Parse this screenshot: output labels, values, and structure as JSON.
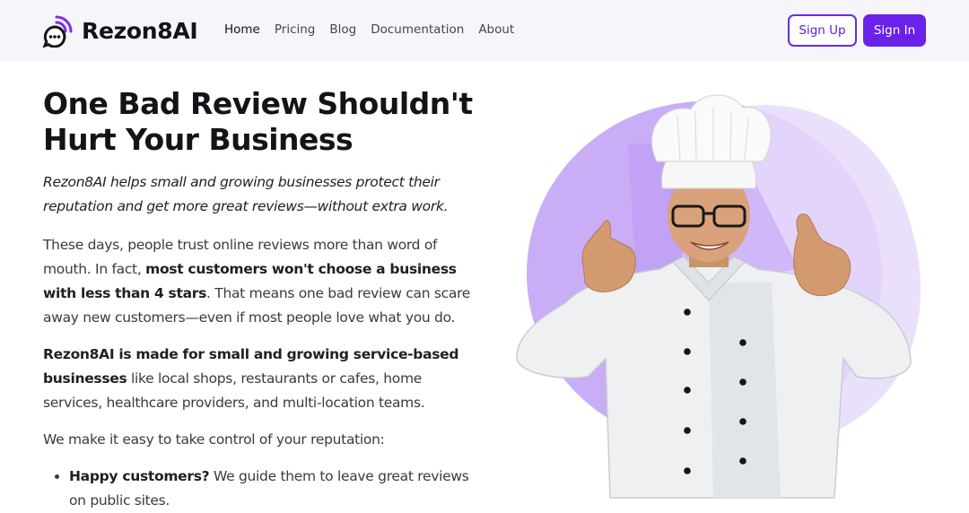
{
  "brand": {
    "name": "Rezon8AI",
    "logo_icon": "chat-signal-icon",
    "accent_color": "#6a22e8"
  },
  "nav": {
    "items": [
      {
        "label": "Home",
        "active": true
      },
      {
        "label": "Pricing",
        "active": false
      },
      {
        "label": "Blog",
        "active": false
      },
      {
        "label": "Documentation",
        "active": false
      },
      {
        "label": "About",
        "active": false
      }
    ]
  },
  "auth": {
    "signup_label": "Sign Up",
    "signin_label": "Sign In"
  },
  "hero": {
    "title_line1": "One Bad Review Shouldn't",
    "title_line2": "Hurt Your Business",
    "tagline": "Rezon8AI helps small and growing businesses protect their reputation and get more great reviews—without extra work.",
    "p1_before": "These days, people trust online reviews more than word of mouth. In fact, ",
    "p1_bold": "most customers won't choose a business with less than 4 stars",
    "p1_after": ". That means one bad review can scare away new customers—even if most people love what you do.",
    "p2_bold": "Rezon8AI is made for small and growing service-based businesses",
    "p2_after": " like local shops, restaurants or cafes, home services, healthcare providers, and multi-location teams.",
    "p3": "We make it easy to take control of your reputation:",
    "bullets": [
      {
        "bold": "Happy customers?",
        "text": " We guide them to leave great reviews on public sites."
      }
    ]
  },
  "hero_image": {
    "subject": "chef giving two thumbs up",
    "blob_colors": [
      "#c7a8f5",
      "#e6d8fb"
    ]
  }
}
